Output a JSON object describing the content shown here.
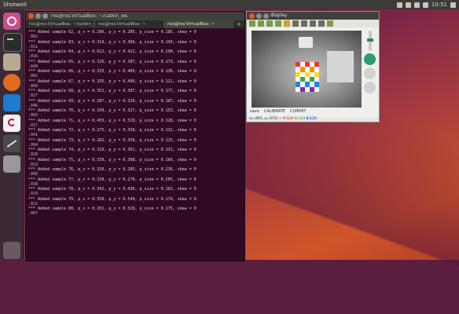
{
  "top_panel": {
    "app_title": "Shotwell",
    "indicators": [
      "network-icon",
      "keyboard-icon",
      "battery-icon",
      "volume-icon",
      "clock"
    ],
    "clock": "10:51"
  },
  "launcher": {
    "items": [
      "dash-icon",
      "terminal-icon",
      "files-icon",
      "firefox-icon",
      "vscode-icon",
      "debian-icon",
      "text-editor-icon",
      "disk-icon",
      "trash-icon"
    ]
  },
  "terminal": {
    "title": "ros@ros-VirtualBox: ~/catkin_ws",
    "tabs": [
      {
        "label": "ros@ros-VirtualBox: ~/catkin_ws",
        "active": false
      },
      {
        "label": "ros@ros-VirtualBox: ~",
        "active": false
      },
      {
        "label": "ros@ros-VirtualBox: ~",
        "active": true
      }
    ],
    "lines": [
      {
        "pre": "*** Added sample 62, p_x = 0.286, p_y = 0.285, p_size = 0.185, skew = 0",
        "num": ".002"
      },
      {
        "pre": "*** Added sample 63, p_x = 0.319, p_y = 0.366, p_size = 0.194, skew = 0",
        "num": ".011"
      },
      {
        "pre": "*** Added sample 64, p_x = 0.622, p_y = 0.421, p_size = 0.298, skew = 0",
        "num": ".016"
      },
      {
        "pre": "*** Added sample 65, p_x = 0.326, p_y = 0.387, p_size = 0.173, skew = 0",
        "num": ".049"
      },
      {
        "pre": "*** Added sample 66, p_x = 0.333, p_y = 0.409, p_size = 0.136, skew = 0",
        "num": ".001"
      },
      {
        "pre": "*** Added sample 67, p_x = 0.335, p_y = 0.406, p_size = 0.121, skew = 0",
        "num": ".009"
      },
      {
        "pre": "*** Added sample 68, p_x = 0.352, p_y = 0.307, p_size = 0.177, skew = 0",
        "num": ".027"
      },
      {
        "pre": "*** Added sample 69, p_x = 0.287, p_y = 0.320, p_size = 0.187, skew = 0",
        "num": ".046"
      },
      {
        "pre": "*** Added sample 70, p_x = 0.299, p_y = 0.327, p_size = 0.153, skew = 0",
        "num": ".003"
      },
      {
        "pre": "*** Added sample 71, p_x = 0.455, p_y = 0.329, p_size = 0.128, skew = 0",
        "num": ".017"
      },
      {
        "pre": "*** Added sample 72, p_x = 0.275, p_y = 0.358, p_size = 0.132, skew = 0",
        "num": ".041"
      },
      {
        "pre": "*** Added sample 73, p_x = 0.282, p_y = 0.358, p_size = 0.125, skew = 0",
        "num": ".004"
      },
      {
        "pre": "*** Added sample 74, p_x = 0.316, p_y = 0.361, p_size = 0.131, skew = 0",
        "num": ".028"
      },
      {
        "pre": "*** Added sample 75, p_x = 0.339, p_y = 0.388, p_size = 0.166, skew = 0",
        "num": ".013"
      },
      {
        "pre": "*** Added sample 76, p_x = 0.326, p_y = 0.285, p_size = 0.236, skew = 0",
        "num": ".006"
      },
      {
        "pre": "*** Added sample 77, p_x = 0.338, p_y = 0.270, p_size = 0.205, skew = 0",
        "num": ".038"
      },
      {
        "pre": "*** Added sample 78, p_x = 0.342, p_y = 0.436, p_size = 0.163, skew = 0",
        "num": ".019"
      },
      {
        "pre": "*** Added sample 79, p_x = 0.358, p_y = 0.549, p_size = 0.179, skew = 0",
        "num": ".022"
      },
      {
        "pre": "*** Added sample 80, p_x = 0.291, p_y = 0.329, p_size = 0.175, skew = 0",
        "num": ".007"
      }
    ]
  },
  "viewer": {
    "title": "display",
    "controls": {
      "left_label": "save",
      "mid_label": "CALIBRATE",
      "commit_label": "COMMIT"
    },
    "status": {
      "coords": "(x=645, y=473) ~",
      "r": "R:124",
      "g": "G:124",
      "b": "B:124"
    },
    "colors": {
      "checker": [
        "#e53935",
        "#fb8c00",
        "#fdd835",
        "#43a047",
        "#1e88e5",
        "#8e24aa"
      ]
    }
  }
}
